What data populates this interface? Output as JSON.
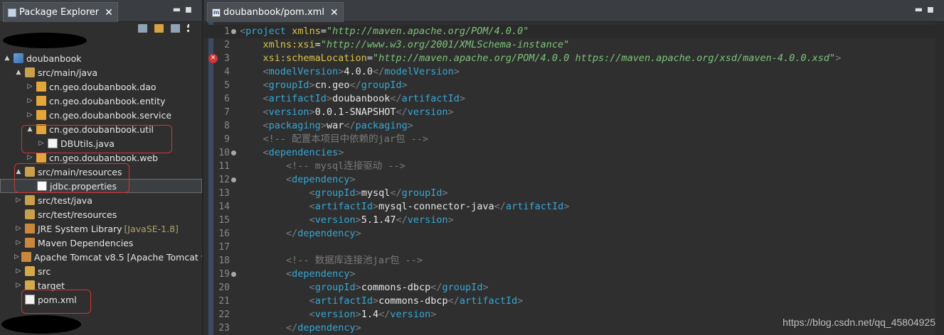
{
  "explorer": {
    "title": "Package Explorer",
    "tree": [
      {
        "arrow": "▲",
        "icon": "proj",
        "label": "doubanbook",
        "indent": 0,
        "name": "tree-project-doubanbook"
      },
      {
        "arrow": "▲",
        "icon": "srcf",
        "label": "src/main/java",
        "indent": 1,
        "name": "tree-src-main-java"
      },
      {
        "arrow": "▷",
        "icon": "pkg",
        "label": "cn.geo.doubanbook.dao",
        "indent": 2,
        "name": "tree-pkg-dao"
      },
      {
        "arrow": "▷",
        "icon": "pkg",
        "label": "cn.geo.doubanbook.entity",
        "indent": 2,
        "name": "tree-pkg-entity"
      },
      {
        "arrow": "▷",
        "icon": "pkg",
        "label": "cn.geo.doubanbook.service",
        "indent": 2,
        "name": "tree-pkg-service"
      },
      {
        "arrow": "▲",
        "icon": "pkg",
        "label": "cn.geo.doubanbook.util",
        "indent": 2,
        "name": "tree-pkg-util"
      },
      {
        "arrow": "▷",
        "icon": "java",
        "label": "DBUtils.java",
        "indent": 3,
        "name": "tree-file-dbutils"
      },
      {
        "arrow": "▷",
        "icon": "pkg",
        "label": "cn.geo.doubanbook.web",
        "indent": 2,
        "name": "tree-pkg-web"
      },
      {
        "arrow": "▲",
        "icon": "srcf",
        "label": "src/main/resources",
        "indent": 1,
        "name": "tree-src-main-resources"
      },
      {
        "arrow": "",
        "icon": "props",
        "label": "jdbc.properties",
        "indent": 2,
        "name": "tree-file-jdbc-properties",
        "selected": true
      },
      {
        "arrow": "▷",
        "icon": "srcf",
        "label": "src/test/java",
        "indent": 1,
        "name": "tree-src-test-java"
      },
      {
        "arrow": "",
        "icon": "srcf",
        "label": "src/test/resources",
        "indent": 1,
        "name": "tree-src-test-resources"
      },
      {
        "arrow": "▷",
        "icon": "lib",
        "label": "JRE System Library",
        "deco": "[JavaSE-1.8]",
        "indent": 1,
        "name": "tree-jre-library"
      },
      {
        "arrow": "▷",
        "icon": "lib",
        "label": "Maven Dependencies",
        "indent": 1,
        "name": "tree-maven-deps"
      },
      {
        "arrow": "▷",
        "icon": "lib",
        "label": "Apache Tomcat v8.5 [Apache Tomcat v",
        "indent": 1,
        "name": "tree-tomcat"
      },
      {
        "arrow": "▷",
        "icon": "folder",
        "label": "src",
        "indent": 1,
        "name": "tree-folder-src"
      },
      {
        "arrow": "▷",
        "icon": "folder",
        "label": "target",
        "indent": 1,
        "name": "tree-folder-target"
      },
      {
        "arrow": "",
        "icon": "xml",
        "label": "pom.xml",
        "indent": 1,
        "name": "tree-file-pom"
      }
    ]
  },
  "editor": {
    "tab_label": "doubanbook/pom.xml",
    "lines": [
      {
        "n": "1",
        "fold": true,
        "cur": true,
        "parts": [
          [
            "br",
            "<"
          ],
          [
            "tag",
            "project"
          ],
          [
            "txt",
            " "
          ],
          [
            "attr",
            "xmlns"
          ],
          [
            "txt",
            "="
          ],
          [
            "str",
            "\"http://maven.apache.org/POM/4.0.0\""
          ]
        ]
      },
      {
        "n": "2",
        "parts": [
          [
            "txt",
            "    "
          ],
          [
            "attr",
            "xmlns:xsi"
          ],
          [
            "txt",
            "="
          ],
          [
            "str",
            "\"http://www.w3.org/2001/XMLSchema-instance\""
          ]
        ]
      },
      {
        "n": "3",
        "err": true,
        "parts": [
          [
            "txt",
            "    "
          ],
          [
            "attr",
            "xsi:schemaLocation"
          ],
          [
            "txt",
            "="
          ],
          [
            "str",
            "\"http://maven.apache.org/POM/4.0.0 https://maven.apache.org/xsd/maven-4.0.0.xsd\""
          ],
          [
            "br",
            ">"
          ]
        ]
      },
      {
        "n": "4",
        "parts": [
          [
            "txt",
            "    "
          ],
          [
            "br",
            "<"
          ],
          [
            "tag",
            "modelVersion"
          ],
          [
            "br",
            ">"
          ],
          [
            "txt",
            "4.0.0"
          ],
          [
            "br",
            "</"
          ],
          [
            "tag",
            "modelVersion"
          ],
          [
            "br",
            ">"
          ]
        ]
      },
      {
        "n": "5",
        "parts": [
          [
            "txt",
            "    "
          ],
          [
            "br",
            "<"
          ],
          [
            "tag",
            "groupId"
          ],
          [
            "br",
            ">"
          ],
          [
            "txt",
            "cn.geo"
          ],
          [
            "br",
            "</"
          ],
          [
            "tag",
            "groupId"
          ],
          [
            "br",
            ">"
          ]
        ]
      },
      {
        "n": "6",
        "parts": [
          [
            "txt",
            "    "
          ],
          [
            "br",
            "<"
          ],
          [
            "tag",
            "artifactId"
          ],
          [
            "br",
            ">"
          ],
          [
            "txt",
            "doubanbook"
          ],
          [
            "br",
            "</"
          ],
          [
            "tag",
            "artifactId"
          ],
          [
            "br",
            ">"
          ]
        ]
      },
      {
        "n": "7",
        "parts": [
          [
            "txt",
            "    "
          ],
          [
            "br",
            "<"
          ],
          [
            "tag",
            "version"
          ],
          [
            "br",
            ">"
          ],
          [
            "txt",
            "0.0.1-SNAPSHOT"
          ],
          [
            "br",
            "</"
          ],
          [
            "tag",
            "version"
          ],
          [
            "br",
            ">"
          ]
        ]
      },
      {
        "n": "8",
        "parts": [
          [
            "txt",
            "    "
          ],
          [
            "br",
            "<"
          ],
          [
            "tag",
            "packaging"
          ],
          [
            "br",
            ">"
          ],
          [
            "txt",
            "war"
          ],
          [
            "br",
            "</"
          ],
          [
            "tag",
            "packaging"
          ],
          [
            "br",
            ">"
          ]
        ]
      },
      {
        "n": "9",
        "parts": [
          [
            "txt",
            "    "
          ],
          [
            "cmt",
            "<!-- 配置本项目中依赖的jar包 -->"
          ]
        ]
      },
      {
        "n": "10",
        "fold": true,
        "parts": [
          [
            "txt",
            "    "
          ],
          [
            "br",
            "<"
          ],
          [
            "tag",
            "dependencies"
          ],
          [
            "br",
            ">"
          ]
        ]
      },
      {
        "n": "11",
        "parts": [
          [
            "txt",
            "        "
          ],
          [
            "cmt",
            "<!-- mysql连接驱动 -->"
          ]
        ]
      },
      {
        "n": "12",
        "fold": true,
        "parts": [
          [
            "txt",
            "        "
          ],
          [
            "br",
            "<"
          ],
          [
            "tag",
            "dependency"
          ],
          [
            "br",
            ">"
          ]
        ]
      },
      {
        "n": "13",
        "parts": [
          [
            "txt",
            "            "
          ],
          [
            "br",
            "<"
          ],
          [
            "tag",
            "groupId"
          ],
          [
            "br",
            ">"
          ],
          [
            "txt",
            "mysql"
          ],
          [
            "br",
            "</"
          ],
          [
            "tag",
            "groupId"
          ],
          [
            "br",
            ">"
          ]
        ]
      },
      {
        "n": "14",
        "parts": [
          [
            "txt",
            "            "
          ],
          [
            "br",
            "<"
          ],
          [
            "tag",
            "artifactId"
          ],
          [
            "br",
            ">"
          ],
          [
            "txt",
            "mysql-connector-java"
          ],
          [
            "br",
            "</"
          ],
          [
            "tag",
            "artifactId"
          ],
          [
            "br",
            ">"
          ]
        ]
      },
      {
        "n": "15",
        "parts": [
          [
            "txt",
            "            "
          ],
          [
            "br",
            "<"
          ],
          [
            "tag",
            "version"
          ],
          [
            "br",
            ">"
          ],
          [
            "txt",
            "5.1.47"
          ],
          [
            "br",
            "</"
          ],
          [
            "tag",
            "version"
          ],
          [
            "br",
            ">"
          ]
        ]
      },
      {
        "n": "16",
        "parts": [
          [
            "txt",
            "        "
          ],
          [
            "br",
            "</"
          ],
          [
            "tag",
            "dependency"
          ],
          [
            "br",
            ">"
          ]
        ]
      },
      {
        "n": "17",
        "parts": []
      },
      {
        "n": "18",
        "parts": [
          [
            "txt",
            "        "
          ],
          [
            "cmt",
            "<!-- 数据库连接池jar包 -->"
          ]
        ]
      },
      {
        "n": "19",
        "fold": true,
        "parts": [
          [
            "txt",
            "        "
          ],
          [
            "br",
            "<"
          ],
          [
            "tag",
            "dependency"
          ],
          [
            "br",
            ">"
          ]
        ]
      },
      {
        "n": "20",
        "parts": [
          [
            "txt",
            "            "
          ],
          [
            "br",
            "<"
          ],
          [
            "tag",
            "groupId"
          ],
          [
            "br",
            ">"
          ],
          [
            "txt",
            "commons-dbcp"
          ],
          [
            "br",
            "</"
          ],
          [
            "tag",
            "groupId"
          ],
          [
            "br",
            ">"
          ]
        ]
      },
      {
        "n": "21",
        "parts": [
          [
            "txt",
            "            "
          ],
          [
            "br",
            "<"
          ],
          [
            "tag",
            "artifactId"
          ],
          [
            "br",
            ">"
          ],
          [
            "txt",
            "commons-dbcp"
          ],
          [
            "br",
            "</"
          ],
          [
            "tag",
            "artifactId"
          ],
          [
            "br",
            ">"
          ]
        ]
      },
      {
        "n": "22",
        "parts": [
          [
            "txt",
            "            "
          ],
          [
            "br",
            "<"
          ],
          [
            "tag",
            "version"
          ],
          [
            "br",
            ">"
          ],
          [
            "txt",
            "1.4"
          ],
          [
            "br",
            "</"
          ],
          [
            "tag",
            "version"
          ],
          [
            "br",
            ">"
          ]
        ]
      },
      {
        "n": "23",
        "parts": [
          [
            "txt",
            "        "
          ],
          [
            "br",
            "</"
          ],
          [
            "tag",
            "dependency"
          ],
          [
            "br",
            ">"
          ]
        ]
      }
    ]
  },
  "watermark": "https://blog.csdn.net/qq_45804925"
}
